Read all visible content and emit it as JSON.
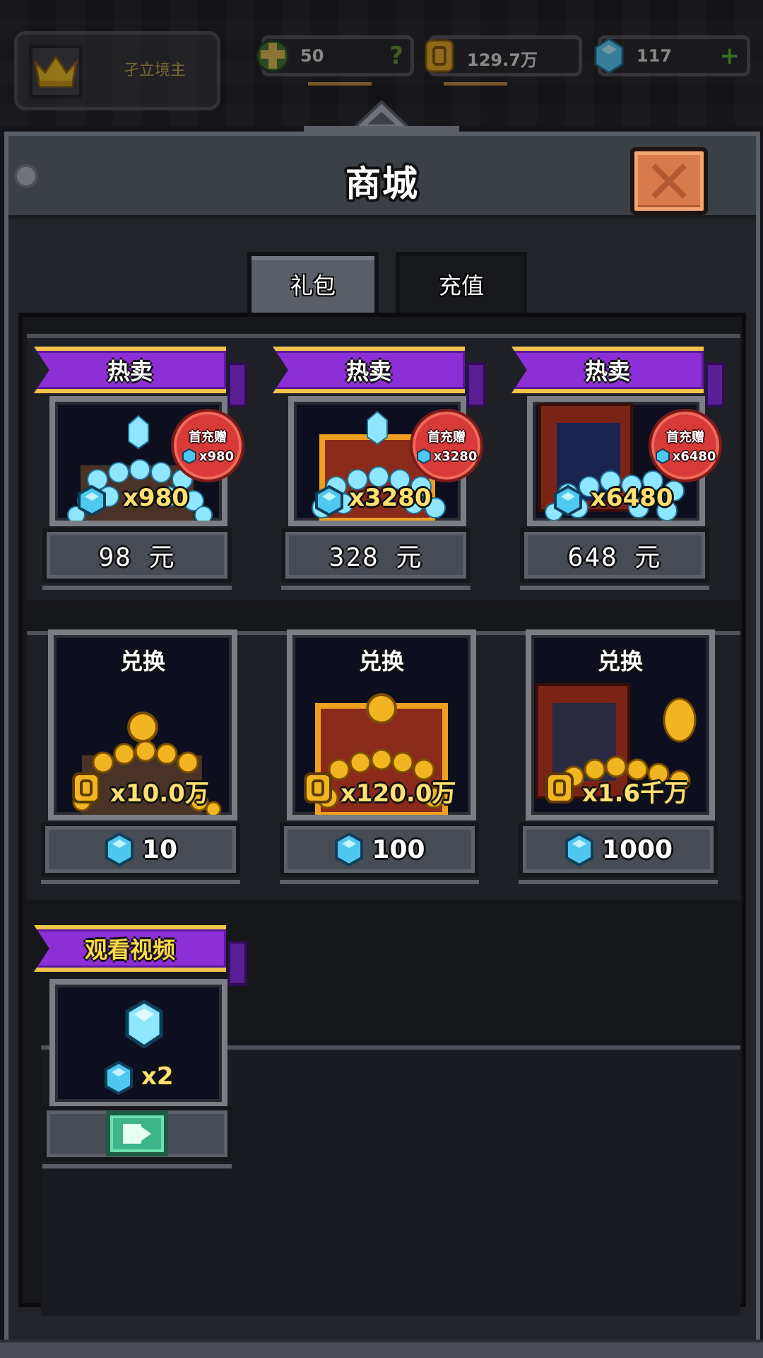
{
  "topbar": {
    "player_name": "孑立境主",
    "resources": [
      {
        "icon": "green-cross-icon",
        "value": "50",
        "side": "?"
      },
      {
        "icon": "gold-coin-icon",
        "value": "129.7万",
        "side": ""
      },
      {
        "icon": "blue-gem-icon",
        "value": "117",
        "side": "+"
      }
    ]
  },
  "panel": {
    "title": "商城",
    "tabs": [
      {
        "label": "礼包",
        "active": true
      },
      {
        "label": "充值",
        "active": false
      }
    ]
  },
  "gift_packs": [
    {
      "ribbon": "热卖",
      "quantity": "x980",
      "badge_title": "首充赠",
      "badge_qty": "x980",
      "price": "98 元"
    },
    {
      "ribbon": "热卖",
      "quantity": "x3280",
      "badge_title": "首充赠",
      "badge_qty": "x3280",
      "price": "328 元"
    },
    {
      "ribbon": "热卖",
      "quantity": "x6480",
      "badge_title": "首充赠",
      "badge_qty": "x6480",
      "price": "648 元"
    }
  ],
  "exchanges": [
    {
      "title": "兑换",
      "quantity": "x10.0万",
      "cost": "10"
    },
    {
      "title": "兑换",
      "quantity": "x120.0万",
      "cost": "100"
    },
    {
      "title": "兑换",
      "quantity": "x1.6千万",
      "cost": "1000"
    }
  ],
  "video_offer": {
    "ribbon": "观看视频",
    "quantity": "x2",
    "button_icon": "play-video-icon"
  },
  "colors": {
    "ribbon_purple": "#8c2fd6",
    "ribbon_border_gold": "#f0c34a",
    "badge_red": "#d83a3a",
    "close_orange": "#d97a4d",
    "video_green": "#3fb58a",
    "gem_blue": "#4fc8f0",
    "coin_gold": "#f0b520"
  }
}
